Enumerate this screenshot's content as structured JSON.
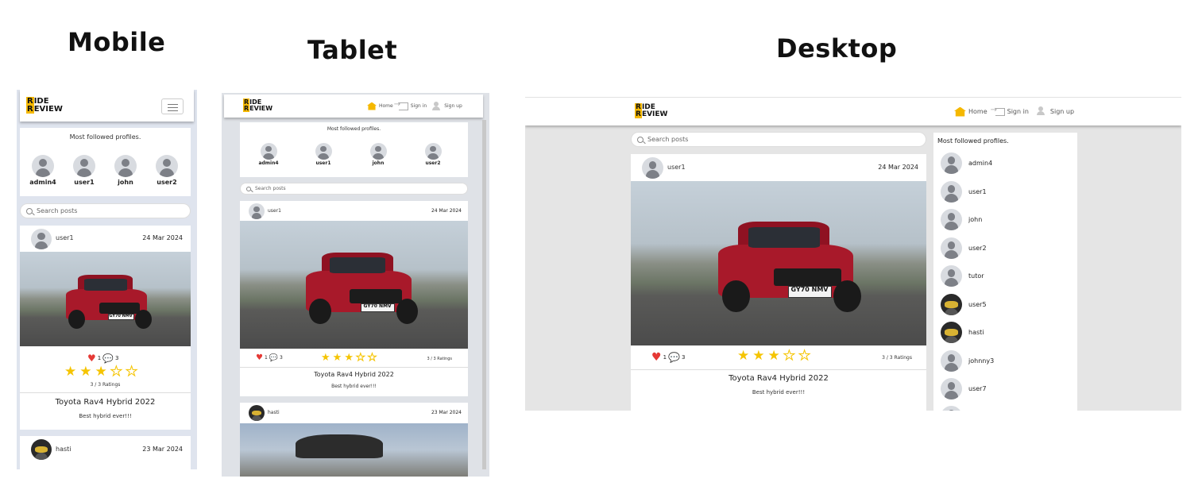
{
  "headings": {
    "mobile": "Mobile",
    "tablet": "Tablet",
    "desktop": "Desktop"
  },
  "brand": {
    "line1": "IDE",
    "line1_first": "R",
    "line2": "EVIEW",
    "line2_first": "R"
  },
  "nav": {
    "home": "Home",
    "signin": "Sign in",
    "signup": "Sign up"
  },
  "popular": {
    "title": "Most followed profiles.",
    "top4": [
      "admin4",
      "user1",
      "john",
      "user2"
    ],
    "desktop_list": [
      "admin4",
      "user1",
      "john",
      "user2",
      "tutor",
      "user5",
      "hasti",
      "johnny3",
      "user7"
    ]
  },
  "search": {
    "placeholder": "Search posts"
  },
  "post1": {
    "owner": "user1",
    "date": "24 Mar 2024",
    "plate": "GY70 NMV",
    "likes": "1",
    "comments": "3",
    "rating_text": "3 / 3 Ratings",
    "rating_value": 3,
    "rating_max": 5,
    "title": "Toyota Rav4 Hybrid 2022",
    "content": "Best hybrid ever!!!"
  },
  "post2": {
    "owner": "hasti",
    "date": "23 Mar 2024"
  },
  "colors": {
    "accent": "#f5b800",
    "heart": "#e53935",
    "page_bg": "#dfe2e7",
    "desktop_bg": "#e5e5e5"
  }
}
